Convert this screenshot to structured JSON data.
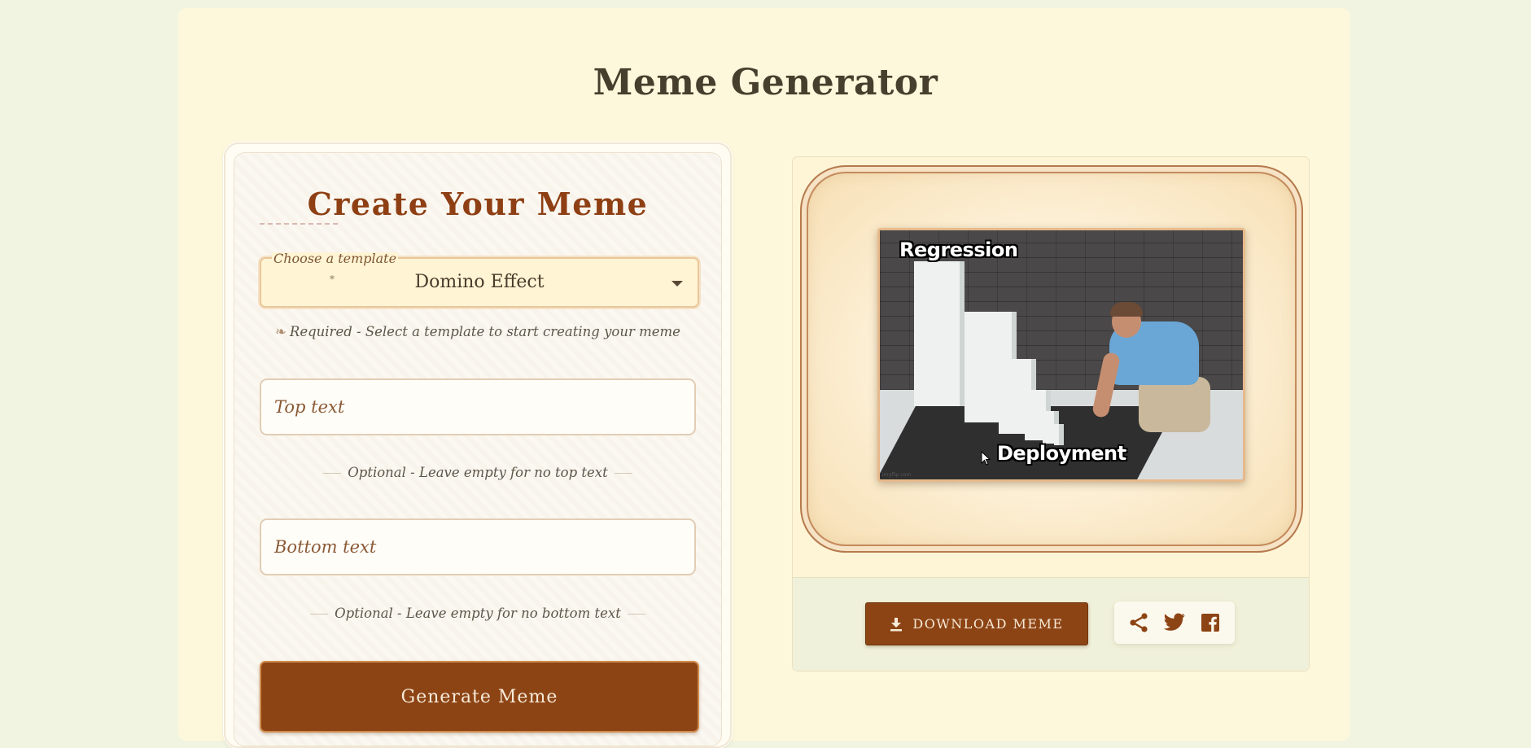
{
  "page": {
    "title": "Meme Generator"
  },
  "form": {
    "heading": "Create Your Meme",
    "template": {
      "label": "Choose a template",
      "marker": "*",
      "value": "Domino Effect",
      "hint_icon": "❧",
      "hint": "Required - Select a template to start creating your meme"
    },
    "top_text": {
      "value": "",
      "placeholder": "Top text",
      "hint": "Optional - Leave empty for no top text"
    },
    "bottom_text": {
      "value": "",
      "placeholder": "Bottom text",
      "hint": "Optional - Leave empty for no bottom text"
    },
    "generate_label": "Generate Meme"
  },
  "preview": {
    "top_caption": "Regression",
    "bottom_caption": "Deployment",
    "watermark": "imgflip.com",
    "download_label": "DOWNLOAD MEME",
    "share_icons": [
      "share-icon",
      "twitter-icon",
      "facebook-icon"
    ]
  },
  "colors": {
    "accent": "#8d4414",
    "heading": "#8e3f13",
    "page_bg": "#f1f4e1",
    "card_bg": "#fdf8dc"
  }
}
